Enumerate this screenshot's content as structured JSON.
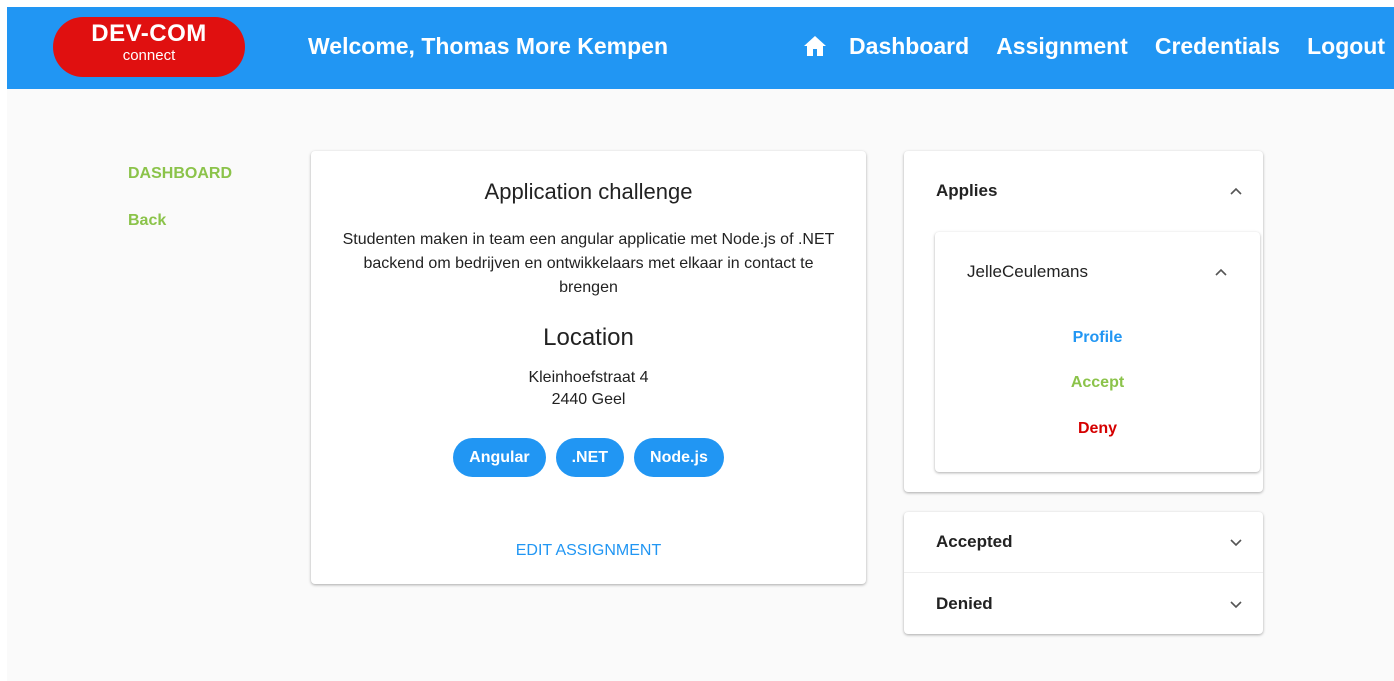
{
  "header": {
    "logo_main": "DEV-COM",
    "logo_sub": "connect",
    "welcome": "Welcome, Thomas More Kempen",
    "nav": [
      {
        "label": "Dashboard"
      },
      {
        "label": "Assignment"
      },
      {
        "label": "Credentials"
      },
      {
        "label": "Logout"
      }
    ]
  },
  "sidebar": {
    "items": [
      {
        "label": "DASHBOARD"
      },
      {
        "label": "Back"
      }
    ]
  },
  "assignment": {
    "title": "Application challenge",
    "description": "Studenten maken in team een angular applicatie met Node.js of .NET backend om bedrijven en ontwikkelaars met elkaar in contact te brengen",
    "location_title": "Location",
    "address_line1": "Kleinhoefstraat 4",
    "address_line2": "2440 Geel",
    "tags": [
      "Angular",
      ".NET",
      "Node.js"
    ],
    "edit_label": "EDIT ASSIGNMENT"
  },
  "applies": {
    "title": "Applies",
    "applicant": {
      "name": "JelleCeulemans",
      "profile_label": "Profile",
      "accept_label": "Accept",
      "deny_label": "Deny"
    }
  },
  "accepted": {
    "title": "Accepted"
  },
  "denied": {
    "title": "Denied"
  },
  "colors": {
    "primary": "#2196f3",
    "accent_green": "#8bc34a",
    "deny_red": "#d50000",
    "logo_red": "#e01010"
  },
  "icons": {
    "home": "home-icon",
    "expanded": "chevron-up-icon",
    "collapsed": "chevron-down-icon"
  }
}
